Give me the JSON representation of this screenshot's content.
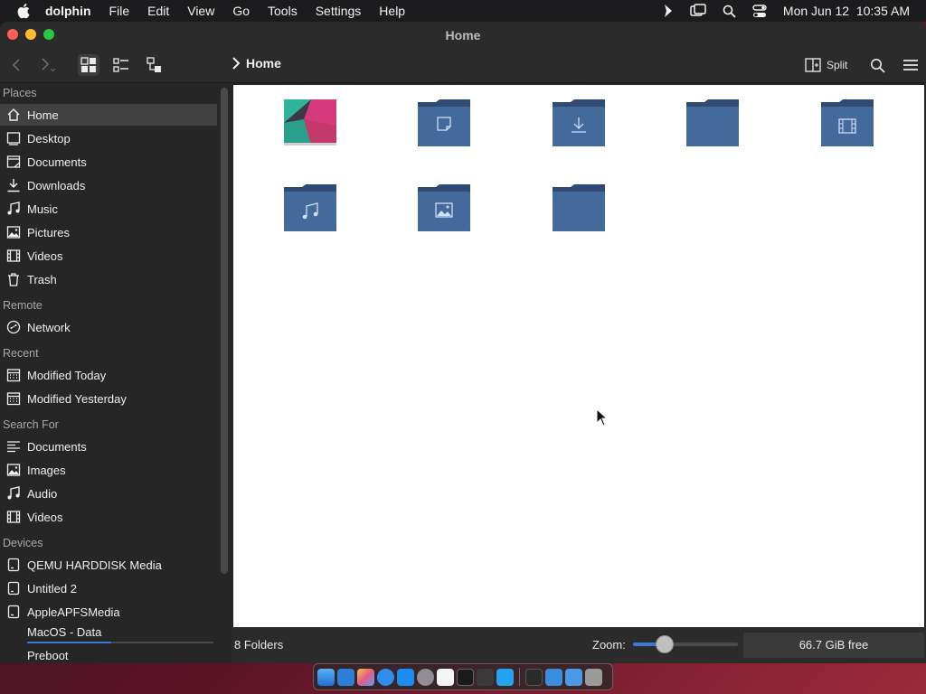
{
  "menubar": {
    "app_name": "dolphin",
    "menus": [
      "File",
      "Edit",
      "View",
      "Go",
      "Tools",
      "Settings",
      "Help"
    ],
    "clock": "Mon Jun 12  10:35 AM",
    "status_icons": [
      "chevron-right-icon",
      "screen-mirroring-icon",
      "spotlight-search-icon",
      "control-center-icon"
    ]
  },
  "window": {
    "title": "Home",
    "breadcrumb": "Home",
    "split_label": "Split"
  },
  "sidebar": {
    "sections": {
      "places": "Places",
      "remote": "Remote",
      "recent": "Recent",
      "search_for": "Search For",
      "devices": "Devices"
    },
    "places": [
      {
        "label": "Home",
        "icon": "home-icon",
        "selected": true
      },
      {
        "label": "Desktop",
        "icon": "desktop-icon"
      },
      {
        "label": "Documents",
        "icon": "documents-icon"
      },
      {
        "label": "Downloads",
        "icon": "downloads-icon"
      },
      {
        "label": "Music",
        "icon": "music-icon"
      },
      {
        "label": "Pictures",
        "icon": "pictures-icon"
      },
      {
        "label": "Videos",
        "icon": "videos-icon"
      },
      {
        "label": "Trash",
        "icon": "trash-icon"
      }
    ],
    "remote": [
      {
        "label": "Network",
        "icon": "network-icon"
      }
    ],
    "recent": [
      {
        "label": "Modified Today",
        "icon": "calendar-icon"
      },
      {
        "label": "Modified Yesterday",
        "icon": "calendar-icon"
      }
    ],
    "search_for": [
      {
        "label": "Documents",
        "icon": "text-lines-icon"
      },
      {
        "label": "Images",
        "icon": "image-icon"
      },
      {
        "label": "Audio",
        "icon": "music-icon"
      },
      {
        "label": "Videos",
        "icon": "videos-icon"
      }
    ],
    "devices": [
      {
        "label": "QEMU HARDDISK Media",
        "icon": "drive-icon"
      },
      {
        "label": "Untitled 2",
        "icon": "drive-icon"
      },
      {
        "label": "AppleAPFSMedia",
        "icon": "drive-icon"
      },
      {
        "label": "MacOS - Data",
        "icon": "",
        "usage_fraction": 0.45
      },
      {
        "label": "Preboot",
        "icon": ""
      }
    ]
  },
  "content": {
    "items": [
      {
        "icon": "desktop-wallpaper-icon"
      },
      {
        "icon": "documents-folder-icon"
      },
      {
        "icon": "downloads-folder-icon"
      },
      {
        "icon": "folder-icon"
      },
      {
        "icon": "videos-folder-icon"
      },
      {
        "icon": "music-folder-icon"
      },
      {
        "icon": "pictures-folder-icon"
      },
      {
        "icon": "folder-icon"
      }
    ]
  },
  "statusbar": {
    "summary": "8 Folders",
    "zoom_label": "Zoom:",
    "zoom_fraction": 0.3,
    "free_space": "66.7 GiB free"
  },
  "colors": {
    "folder_body": "#44699b",
    "folder_tab": "#2f4b73",
    "accent": "#3a78d8",
    "sidebar_bg": "#262626",
    "content_bg": "#ffffff"
  }
}
